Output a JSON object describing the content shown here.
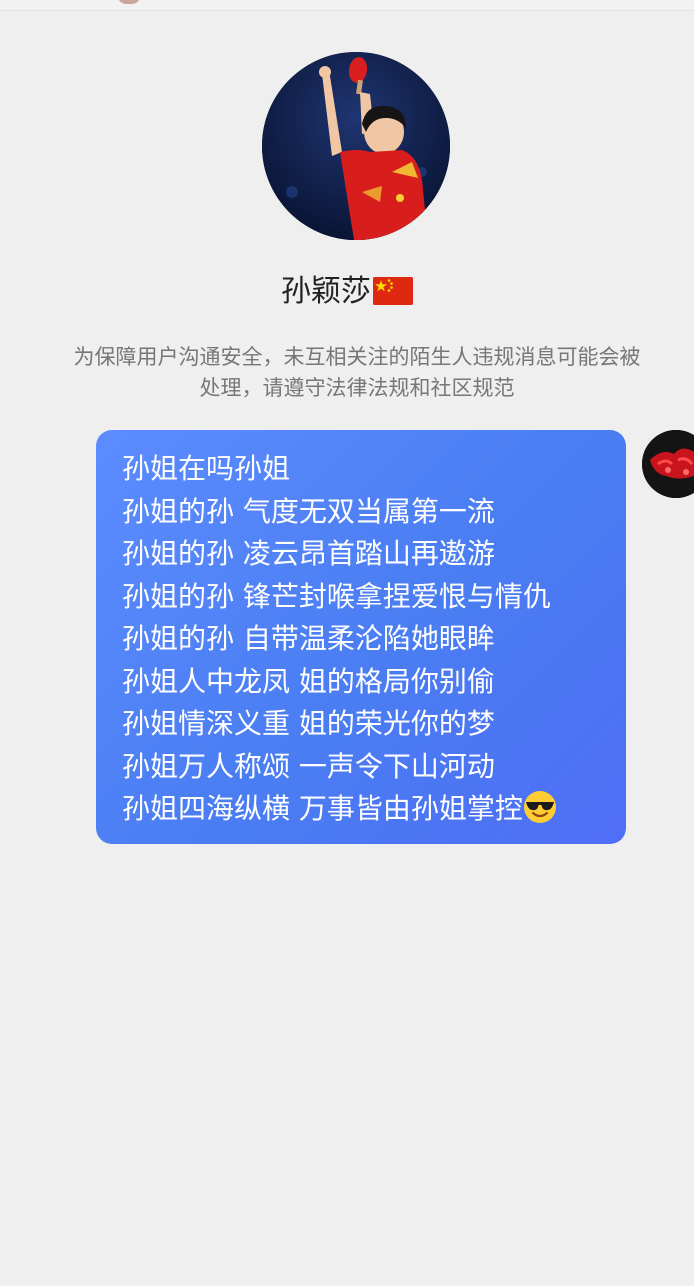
{
  "conversation": {
    "profile": {
      "name": "孙颖莎",
      "flag_icon": "china-flag-icon",
      "avatar_icon": "table-tennis-player-photo"
    },
    "notice": "为保障用户沟通安全，未互相关注的陌生人违规消息可能会被处理，请遵守法律法规和社区规范",
    "sent_message": {
      "lines": [
        "孙姐在吗孙姐",
        "孙姐的孙 气度无双当属第一流",
        "孙姐的孙 凌云昂首踏山再遨游",
        "孙姐的孙 锋芒封喉拿捏爱恨与情仇",
        "孙姐的孙 自带温柔沦陷她眼眸",
        "孙姐人中龙凤 姐的格局你别偷",
        "孙姐情深义重 姐的荣光你的梦",
        "孙姐万人称颂 一声令下山河动",
        "孙姐四海纵横 万事皆由孙姐掌控"
      ],
      "trailing_emoji": "smiling-face-with-sunglasses-icon",
      "bubble_color": "#4f7ff5",
      "text_color": "#ffffff"
    },
    "sender": {
      "avatar_icon": "sender-avatar-photo"
    }
  },
  "colors": {
    "background": "#efefef",
    "notice_text": "#777777",
    "name_text": "#222222"
  }
}
